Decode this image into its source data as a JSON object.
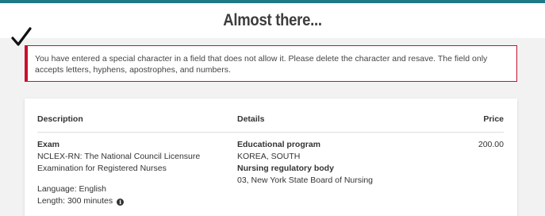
{
  "header": {
    "title": "Almost there..."
  },
  "alert": {
    "message": "You have entered a special character in a field that does not allow it.  Please delete the character and resave. The field only accepts letters, hyphens, apostrophes, and numbers."
  },
  "table": {
    "columns": {
      "description": "Description",
      "details": "Details",
      "price": "Price"
    },
    "row": {
      "exam_label": "Exam",
      "exam_name": "NCLEX-RN: The National Council Licensure Examination for Registered Nurses",
      "language": "Language: English",
      "length": "Length: 300 minutes",
      "program_label": "Educational program",
      "program_value": "KOREA, SOUTH",
      "body_label": "Nursing regulatory body",
      "body_value": "03, New York State Board of Nursing",
      "price": "200.00"
    }
  },
  "icons": {
    "check": "checkmark-icon",
    "info": "info-icon"
  },
  "colors": {
    "accent": "#1f7a86",
    "error": "#c8102e"
  }
}
